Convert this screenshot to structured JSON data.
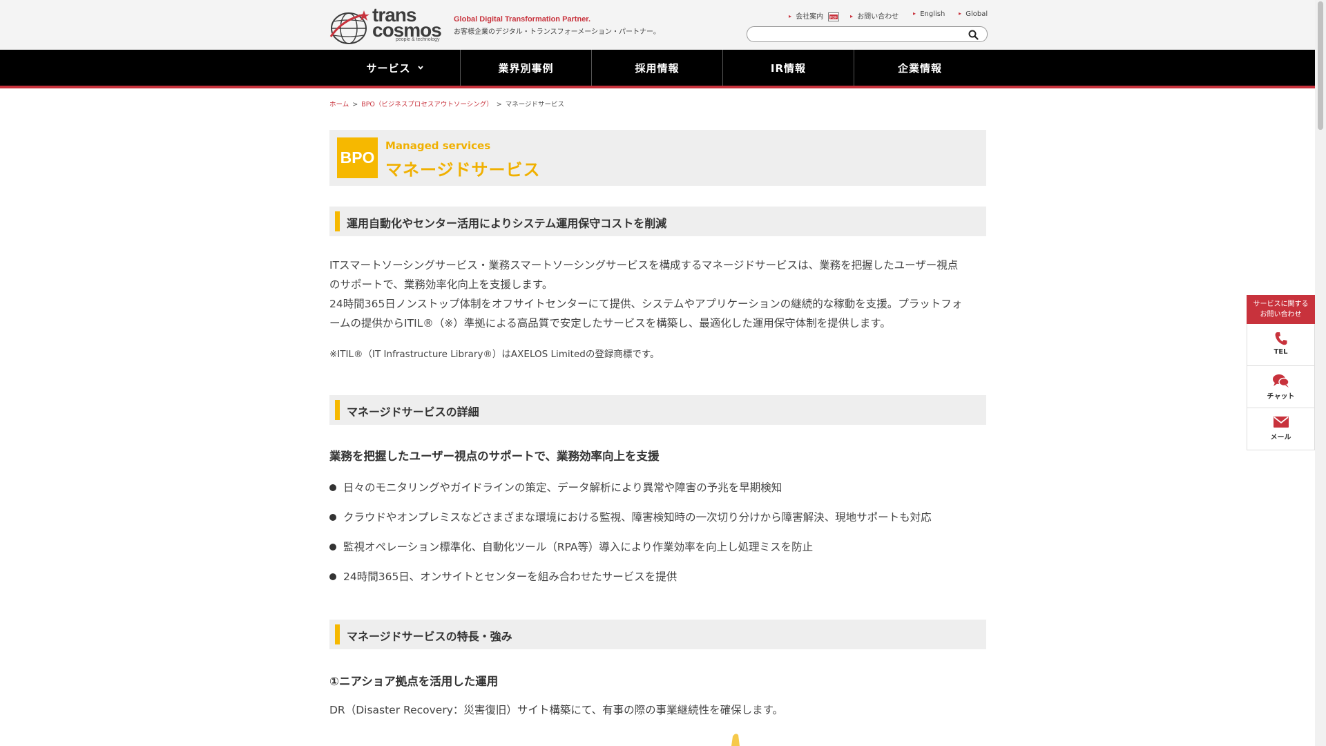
{
  "header": {
    "logo_text_1": "trans",
    "logo_text_2": "cosmos",
    "logo_sub": "people & technology",
    "tagline_en": "Global Digital Transformation Partner.",
    "tagline_jp": "お客様企業のデジタル・トランスフォーメーション・パートナー。",
    "util_links": [
      "会社案内",
      "お問い合わせ",
      "English",
      "Global"
    ],
    "search_placeholder": ""
  },
  "nav": {
    "items": [
      "サービス",
      "業界別事例",
      "採用情報",
      "IR情報",
      "企業情報"
    ]
  },
  "breadcrumb": {
    "home": "ホーム",
    "parent": "BPO（ビジネスプロセスアウトソーシング）",
    "current": "マネージドサービス",
    "sep": ">"
  },
  "title": {
    "badge": "BPO",
    "en": "Managed services",
    "jp": "マネージドサービス"
  },
  "sections": {
    "s1": "運用自動化やセンター活用によりシステム運用保守コストを削減",
    "s2": "マネージドサービスの詳細",
    "s3": "マネージドサービスの特長・強み"
  },
  "intro": {
    "p1a": "ITスマートソーシングサービス・業務スマートソーシングサービスを構成するマネージドサービスは、業務を把握したユーザー視点",
    "p1b": "のサポートで、業務効率化向上を支援します。",
    "p2a": "24時間365日ノンストップ体制をオフサイトセンターにて提供、システムやアプリケーションの継続的な稼動を支援。プラットフォ",
    "p2b": "ームの提供からITIL®（※）準拠による高品質で安定したサービスを構築し、最適化した運用保守体制を提供します。",
    "note": "※ITIL®（IT Infrastructure Library®）はAXELOS Limitedの登録商標です。"
  },
  "details": {
    "heading": "業務を把握したユーザー視点のサポートで、業務効率向上を支援",
    "bullets": [
      "日々のモニタリングやガイドラインの策定、データ解析により異常や障害の予兆を早期検知",
      "クラウドやオンプレミスなどさまざまな環境における監視、障害検知時の一次切り分けから障害解決、現地サポートも対応",
      "監視オペレーション標準化、自動化ツール（RPA等）導入により作業効率を向上し処理ミスを防止",
      "24時間365日、オンサイトとセンターを組み合わせたサービスを提供"
    ]
  },
  "features": {
    "heading": "①ニアショア拠点を活用した運用",
    "text": "DR（Disaster Recovery：災害復旧）サイト構築にて、有事の際の事業継続性を確保します。"
  },
  "side": {
    "top_line1": "サービスに関する",
    "top_line2": "お問い合わせ",
    "tel": "TEL",
    "chat": "チャット",
    "mail": "メール"
  },
  "colors": {
    "brand_red": "#c8323c",
    "accent_yellow": "#f6b800",
    "nav_bg": "#000000"
  }
}
